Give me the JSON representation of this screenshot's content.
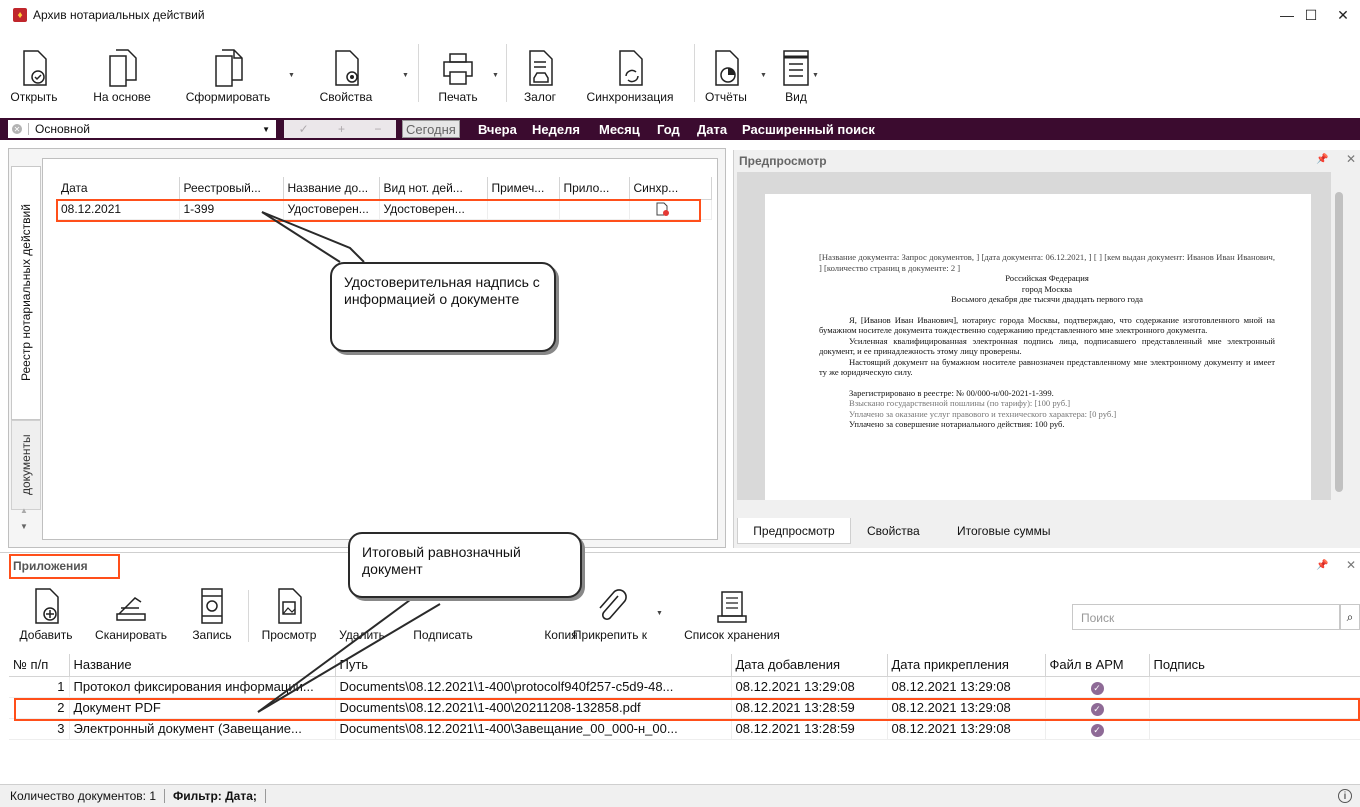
{
  "window": {
    "title": "Архив нотариальных действий"
  },
  "ribbon": {
    "open": "Открыть",
    "based_on": "На основе",
    "form": "Сформировать",
    "properties": "Свойства",
    "print": "Печать",
    "pledge": "Залог",
    "sync": "Синхронизация",
    "reports": "Отчёты",
    "view": "Вид"
  },
  "filterbar": {
    "profile": "Основной",
    "periods": [
      "Сегодня",
      "Вчера",
      "Неделя",
      "Месяц",
      "Год",
      "Дата",
      "Расширенный поиск"
    ]
  },
  "left_tabs": {
    "registry": "Реестр нотариальных действий",
    "documents": "документы"
  },
  "registry": {
    "columns": [
      "Дата",
      "Реестровый...",
      "Название до...",
      "Вид нот. дей...",
      "Примеч...",
      "Прило...",
      "Синхр..."
    ],
    "rows": [
      {
        "date": "08.12.2021",
        "number": "1-399",
        "name": "Удостоверен...",
        "kind": "Удостоверен...",
        "note": "",
        "attach": ""
      }
    ]
  },
  "callouts": {
    "top": "Удостоверительная надпись с информацией о документе",
    "bottom": "Итоговый равнозначный документ"
  },
  "preview": {
    "title": "Предпросмотр",
    "tabs": [
      "Предпросмотр",
      "Свойства",
      "Итоговые суммы"
    ],
    "doc": {
      "l1": "[Название документа: Запрос документов, ] [дата документа: 06.12.2021, ] [ ] [кем выдан документ: Иванов Иван Иванович, ] [количество страниц в документе: 2 ]",
      "l2": "Российская Федерация",
      "l3": "город Москва",
      "l4": "Восьмого декабря две тысячи двадцать первого года",
      "p1": "Я, [Иванов Иван Иванович], нотариус города Москвы, подтверждаю, что содержание изготовленного мной на бумажном носителе документа тождественно содержанию представленного мне электронного документа.",
      "p2": "Усиленная квалифицированная электронная подпись лица, подписавшего представленный мне электронный документ, и ее принадлежность этому лицу проверены.",
      "p3": "Настоящий документ на бумажном носителе равнозначен представленному мне электронному документу и имеет ту же юридическую силу.",
      "r1": "Зарегистрировано в реестре: № 00/000-н/00-2021-1-399.",
      "r2": "Взыскано государственной пошлины (по тарифу): [100 руб.]",
      "r3": "Уплачено за оказание услуг правового и технического характера: [0 руб.]",
      "r4": "Уплачено за совершение нотариального действия: 100 руб."
    }
  },
  "attachments": {
    "title": "Приложения",
    "toolbar": {
      "add": "Добавить",
      "scan": "Сканировать",
      "record": "Запись",
      "view": "Просмотр",
      "delete": "Удалить",
      "sign": "Подписать",
      "copy": "Копия",
      "attach": "Прикрепить к",
      "storage": "Список хранения"
    },
    "search_placeholder": "Поиск",
    "columns": [
      "№ п/п",
      "Название",
      "Путь",
      "Дата добавления",
      "Дата прикрепления",
      "Файл в АРМ",
      "Подпись"
    ],
    "rows": [
      {
        "n": "1",
        "name": "Протокол фиксирования информации...",
        "path": "Documents\\08.12.2021\\1-400\\protocolf940f257-c5d9-48...",
        "added": "08.12.2021 13:29:08",
        "attached": "08.12.2021 13:29:08"
      },
      {
        "n": "2",
        "name": "Документ PDF",
        "path": "Documents\\08.12.2021\\1-400\\20211208-132858.pdf",
        "added": "08.12.2021 13:28:59",
        "attached": "08.12.2021 13:29:08"
      },
      {
        "n": "3",
        "name": "Электронный документ (Завещание...",
        "path": "Documents\\08.12.2021\\1-400\\Завещание_00_000-н_00...",
        "added": "08.12.2021 13:28:59",
        "attached": "08.12.2021 13:29:08"
      }
    ]
  },
  "statusbar": {
    "count": "Количество документов: 1",
    "filter": "Фильтр: Дата;"
  }
}
